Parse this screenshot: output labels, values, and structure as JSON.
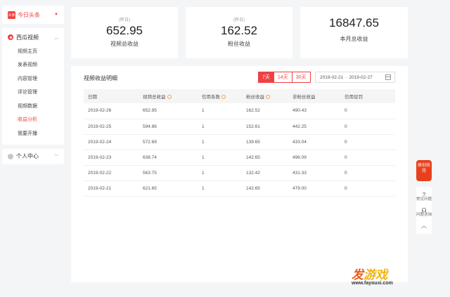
{
  "sidebar": {
    "brand": "今日头条",
    "brand_logo": "头条",
    "section": "西瓜视频",
    "items": [
      {
        "label": "视频主页"
      },
      {
        "label": "发表视频"
      },
      {
        "label": "内容管理"
      },
      {
        "label": "评论管理"
      },
      {
        "label": "视频数据"
      },
      {
        "label": "收益分析"
      },
      {
        "label": "我要开播"
      }
    ],
    "user_center": "个人中心"
  },
  "stats": [
    {
      "top": "(昨日)",
      "value": "652.95",
      "label": "视频总收益"
    },
    {
      "top": "(昨日)",
      "value": "162.52",
      "label": "粉丝收益"
    },
    {
      "top": "",
      "value": "16847.65",
      "label": "本月总收益"
    }
  ],
  "panel": {
    "title": "视频收益明细",
    "ranges": [
      "7天",
      "14天",
      "30天"
    ],
    "date_from": "2019-02-21",
    "date_sep": "-",
    "date_to": "2019-02-27"
  },
  "table": {
    "headers": [
      "日期",
      "视频总收益",
      "信用系数",
      "粉丝收益",
      "非粉丝收益",
      "信用惩罚"
    ],
    "rows": [
      [
        "2019-02-26",
        "652.95",
        "1",
        "162.52",
        "490.43",
        "0"
      ],
      [
        "2019-02-25",
        "594.86",
        "1",
        "152.61",
        "442.25",
        "0"
      ],
      [
        "2019-02-24",
        "572.69",
        "1",
        "139.65",
        "433.04",
        "0"
      ],
      [
        "2019-02-23",
        "638.74",
        "1",
        "142.65",
        "496.09",
        "0"
      ],
      [
        "2019-02-22",
        "563.75",
        "1",
        "132.42",
        "431.33",
        "0"
      ],
      [
        "2019-02-21",
        "621.65",
        "1",
        "142.65",
        "479.00",
        "0"
      ]
    ]
  },
  "float": {
    "badge": "原创扶持",
    "faq": "常见问题",
    "consult": "问题咨询",
    "top_icon": "chevron-up-icon"
  },
  "watermark": {
    "a": "发",
    "b": "游戏",
    "url": "www.fayouxi.com"
  },
  "colors": {
    "accent": "#f04142",
    "background": "#f4f5f6"
  }
}
